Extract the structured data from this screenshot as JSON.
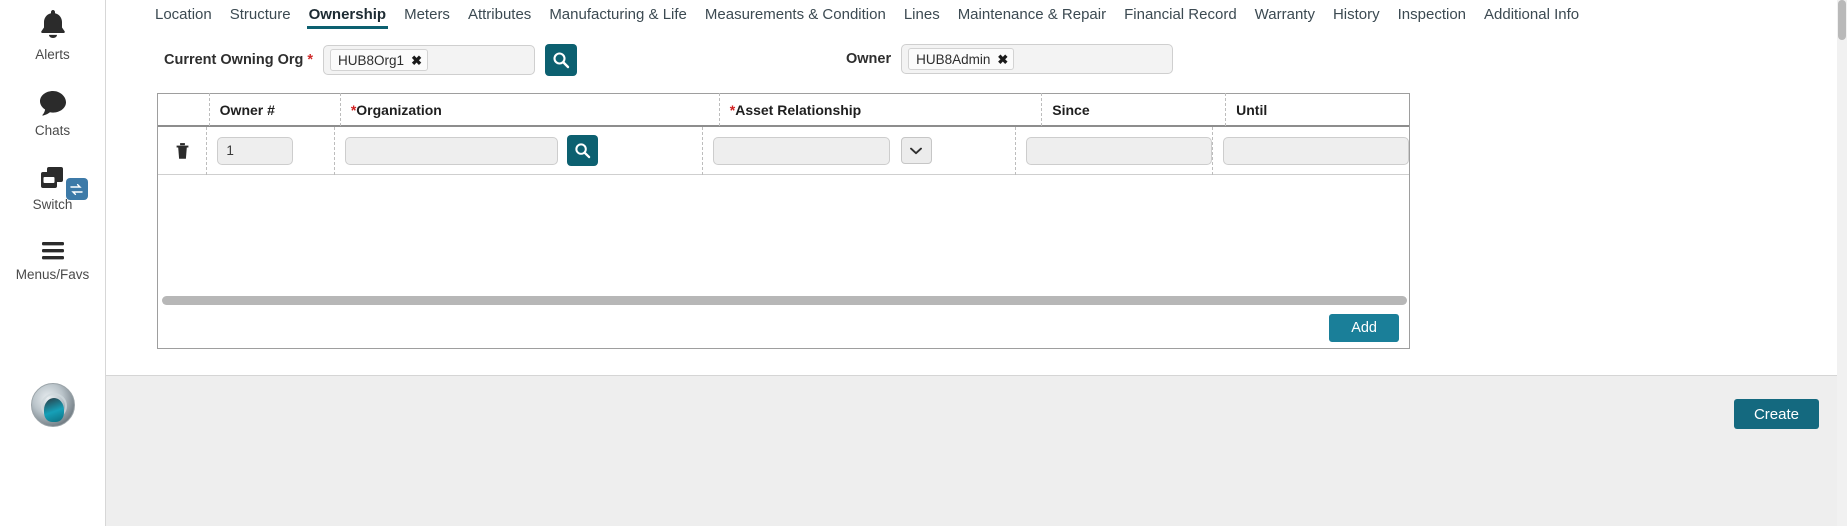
{
  "sidebar": {
    "items": [
      {
        "label": "Alerts",
        "icon": "bell-icon"
      },
      {
        "label": "Chats",
        "icon": "chat-bubble-icon"
      },
      {
        "label": "Switch",
        "icon": "switch-windows-icon",
        "badge_icon": "swap-arrows-icon"
      },
      {
        "label": "Menus/Favs",
        "icon": "hamburger-menu-icon"
      }
    ],
    "avatar_name": "user-avatar"
  },
  "tabs": [
    {
      "label": "Location",
      "active": false
    },
    {
      "label": "Structure",
      "active": false
    },
    {
      "label": "Ownership",
      "active": true
    },
    {
      "label": "Meters",
      "active": false
    },
    {
      "label": "Attributes",
      "active": false
    },
    {
      "label": "Manufacturing & Life",
      "active": false
    },
    {
      "label": "Measurements & Condition",
      "active": false
    },
    {
      "label": "Lines",
      "active": false
    },
    {
      "label": "Maintenance & Repair",
      "active": false
    },
    {
      "label": "Financial Record",
      "active": false
    },
    {
      "label": "Warranty",
      "active": false
    },
    {
      "label": "History",
      "active": false
    },
    {
      "label": "Inspection",
      "active": false
    },
    {
      "label": "Additional Info",
      "active": false
    }
  ],
  "form": {
    "owning_org": {
      "label": "Current Owning Org",
      "required_marker": "*",
      "chip_value": "HUB8Org1",
      "chip_remove_glyph": "✖",
      "placeholder": "",
      "search_icon": "search-icon"
    },
    "owner": {
      "label": "Owner",
      "chip_value": "HUB8Admin",
      "chip_remove_glyph": "✖",
      "placeholder": ""
    }
  },
  "table": {
    "columns": [
      {
        "key": "delete",
        "header": "",
        "required": false
      },
      {
        "key": "owner_num",
        "header": "Owner #",
        "required": false
      },
      {
        "key": "organization",
        "header": "Organization",
        "required": true
      },
      {
        "key": "asset_relationship",
        "header": "Asset Relationship",
        "required": true
      },
      {
        "key": "since",
        "header": "Since",
        "required": false
      },
      {
        "key": "until",
        "header": "Until",
        "required": false
      }
    ],
    "required_marker": "*",
    "rows": [
      {
        "owner_num": "1",
        "organization": "",
        "asset_relationship": "",
        "since": "",
        "until": "",
        "delete_icon": "trash-icon",
        "org_search_icon": "search-icon",
        "rel_dropdown_icon": "chevron-down-icon"
      }
    ],
    "add_label": "Add"
  },
  "footer": {
    "create_label": "Create"
  },
  "colors": {
    "accent_teal": "#0c6070",
    "add_button": "#1a7f99",
    "create_button": "#14697f",
    "required_red": "#cf2a2a",
    "bottom_bar": "#eeeeee"
  }
}
